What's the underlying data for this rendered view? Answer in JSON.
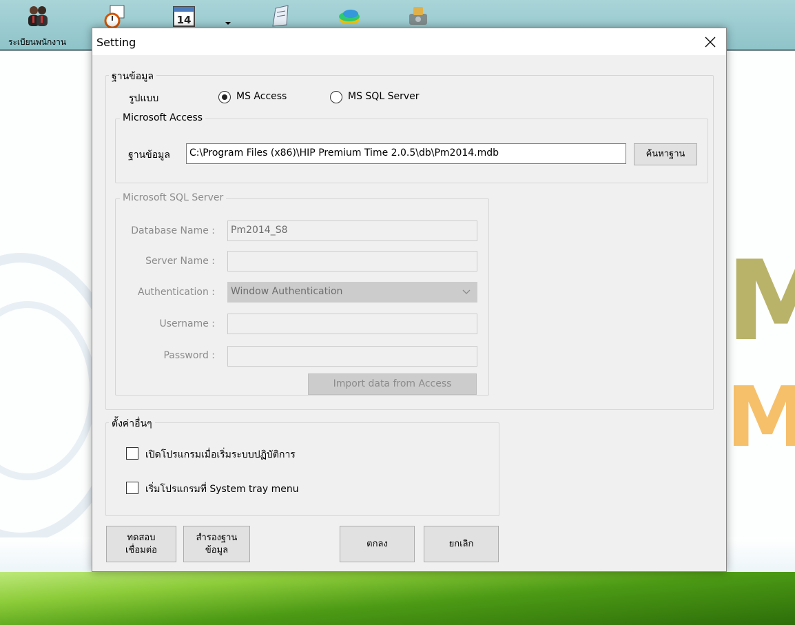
{
  "app": {
    "toolbar_items": [
      {
        "label": "ระเบียนพนักงาน",
        "icon": "employees-icon"
      },
      {
        "label": "",
        "icon": "clock-calendar-icon"
      },
      {
        "label": "",
        "icon": "calendar-14-icon",
        "calendar_day": "14"
      },
      {
        "label": "",
        "icon": "document-icon"
      },
      {
        "label": "",
        "icon": "database-chart-icon"
      },
      {
        "label": "",
        "icon": "tools-icon"
      }
    ],
    "logo_letters_top": "M",
    "logo_letters_bottom": "M"
  },
  "dialog": {
    "title": "Setting",
    "database_group": {
      "legend": "ฐานข้อมูล",
      "type_label": "รูปแบบ",
      "options": [
        {
          "label": "MS Access",
          "checked": true
        },
        {
          "label": "MS SQL Server",
          "checked": false
        }
      ]
    },
    "access_group": {
      "legend": "Microsoft Access",
      "db_label": "ฐานข้อมูล",
      "db_path": "C:\\Program Files (x86)\\HIP Premium Time 2.0.5\\db\\Pm2014.mdb",
      "browse_button": "ค้นหาฐาน"
    },
    "sql_group": {
      "legend": "Microsoft SQL Server",
      "database_name_label": "Database Name :",
      "database_name_value": "Pm2014_S8",
      "server_name_label": "Server Name :",
      "server_name_value": "",
      "authentication_label": "Authentication :",
      "authentication_value": "Window Authentication",
      "username_label": "Username :",
      "username_value": "",
      "password_label": "Password :",
      "password_value": "",
      "import_button": "Import data from Access"
    },
    "other_group": {
      "legend": "ตั้งค่าอื่นๆ",
      "startup_checkbox": "เปิดโปรแกรมเมื่อเริ่มระบบปฏิบัติการ",
      "tray_checkbox": "เริ่มโปรแกรมที่ System tray menu"
    },
    "buttons": {
      "test_line1": "ทดสอบ",
      "test_line2": "เชื่อมต่อ",
      "backup_line1": "สำรองฐาน",
      "backup_line2": "ข้อมูล",
      "ok": "ตกลง",
      "cancel": "ยกเลิก"
    }
  },
  "colors": {
    "toolbar": "#9ccbd1",
    "dialog_bg": "#f0f0f0",
    "disabled_text": "#8c8c8c"
  }
}
